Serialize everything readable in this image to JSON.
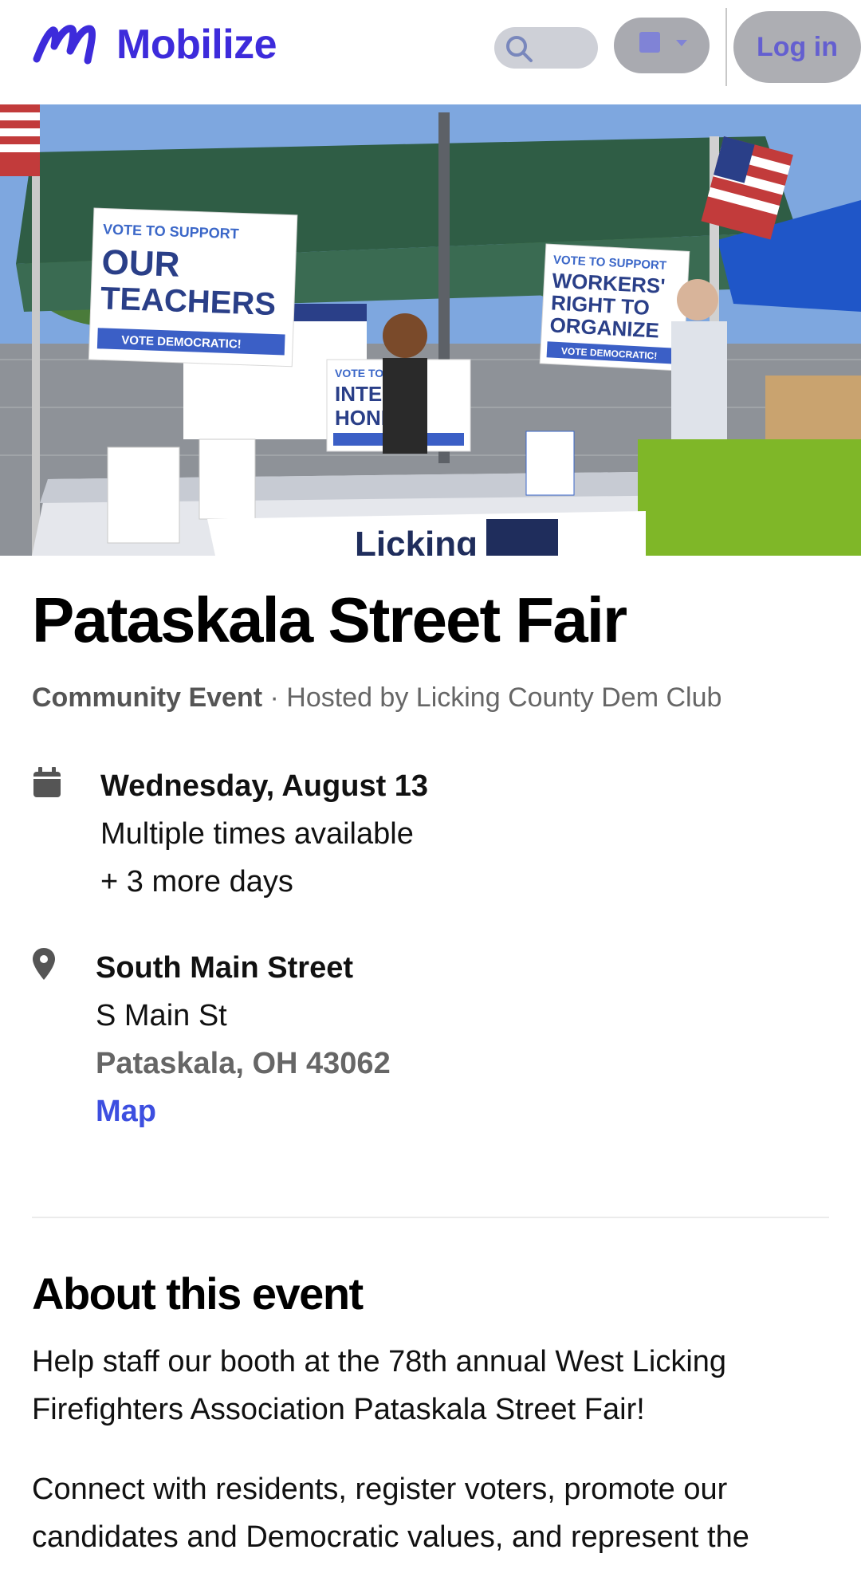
{
  "header": {
    "brand": "Mobilize",
    "login_label": "Log in",
    "brand_color": "#3d2bdb"
  },
  "event": {
    "title": "Pataskala Street Fair",
    "type": "Community Event",
    "host_text": " · Hosted by Licking County Dem Club",
    "date": {
      "day": "Wednesday, August 13",
      "times": "Multiple times available",
      "more_days": "+ 3 more days"
    },
    "location": {
      "name": "South Main Street",
      "street": "S Main St",
      "city": "Pataskala, OH 43062",
      "map_label": "Map"
    }
  },
  "photo": {
    "sign_teachers_small": "VOTE TO SUPPORT",
    "sign_teachers_big1": "OUR",
    "sign_teachers_big2": "TEACHERS",
    "sign_teachers_bottom": "VOTE DEMOCRATIC!",
    "sign_workers_small": "VOTE TO SUPPORT",
    "sign_workers_big1": "WORKERS'",
    "sign_workers_big2": "RIGHT TO",
    "sign_workers_big3": "ORGANIZE",
    "sign_workers_bottom": "VOTE DEMOCRATIC!",
    "sign_intel_small": "VOTE TO KEEP",
    "sign_intel_big1": "INTEL",
    "sign_intel_big2": "HONEST",
    "banner_text": "Licking"
  },
  "about": {
    "heading": "About this event",
    "paragraph1": "Help staff our booth at the 78th annual West Licking Firefighters Association Pataskala Street Fair!",
    "paragraph2_line1": "Connect with residents, register voters, promote our",
    "paragraph2_line2": "candidates and Democratic values, and represent the"
  }
}
